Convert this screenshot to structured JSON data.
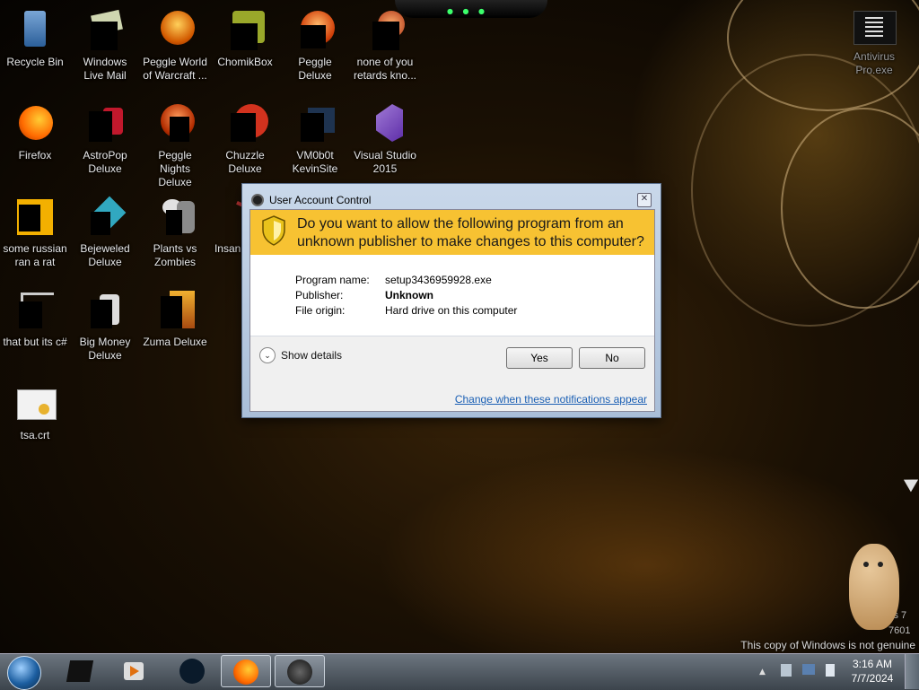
{
  "desktop": {
    "icons": [
      {
        "label": "Recycle Bin",
        "icon": "recycle-bin-icon"
      },
      {
        "label": "Windows Live Mail",
        "icon": "mail-icon"
      },
      {
        "label": "Peggle World of Warcraft ...",
        "icon": "peggle-icon"
      },
      {
        "label": "ChomikBox",
        "icon": "chomikbox-icon"
      },
      {
        "label": "Peggle Deluxe",
        "icon": "peggle-icon"
      },
      {
        "label": "none of you retards kno...",
        "icon": "app-icon"
      },
      {
        "label": "Firefox",
        "icon": "firefox-icon"
      },
      {
        "label": "AstroPop Deluxe",
        "icon": "astropop-icon"
      },
      {
        "label": "Peggle Nights Deluxe",
        "icon": "peggle-icon"
      },
      {
        "label": "Chuzzle Deluxe",
        "icon": "chuzzle-icon"
      },
      {
        "label": "VM0b0t KevinSite",
        "icon": "shortcut-icon"
      },
      {
        "label": "Visual Studio 2015",
        "icon": "visual-studio-icon"
      },
      {
        "label": "some russian ran a rat",
        "icon": "java-icon"
      },
      {
        "label": "Bejeweled Deluxe",
        "icon": "bejeweled-icon"
      },
      {
        "label": "Plants vs Zombies",
        "icon": "plants-vs-zombies-icon"
      },
      {
        "label": "Insan... De...",
        "icon": "app-icon"
      },
      {
        "label": "that but its c#",
        "icon": "shortcut-icon"
      },
      {
        "label": "Big Money Deluxe",
        "icon": "big-money-icon"
      },
      {
        "label": "Zuma Deluxe",
        "icon": "zuma-icon"
      },
      {
        "label": "tsa.crt",
        "icon": "certificate-icon"
      }
    ],
    "right_icon": {
      "label": "Antivirus Pro.exe",
      "icon": "antivirus-icon"
    }
  },
  "uac": {
    "title": "User Account Control",
    "question": "Do you want to allow the following program from an unknown publisher to make changes to this computer?",
    "program_name_label": "Program name:",
    "program_name": "setup3436959928.exe",
    "publisher_label": "Publisher:",
    "publisher": "Unknown",
    "file_origin_label": "File origin:",
    "file_origin": "Hard drive on this computer",
    "show_details": "Show details",
    "yes": "Yes",
    "no": "No",
    "link": "Change when these notifications appear"
  },
  "watermark": {
    "line1": "vs 7",
    "line2": "7601",
    "line3": "This copy of Windows is not genuine"
  },
  "taskbar": {
    "time": "3:16 AM",
    "date": "7/7/2024"
  }
}
